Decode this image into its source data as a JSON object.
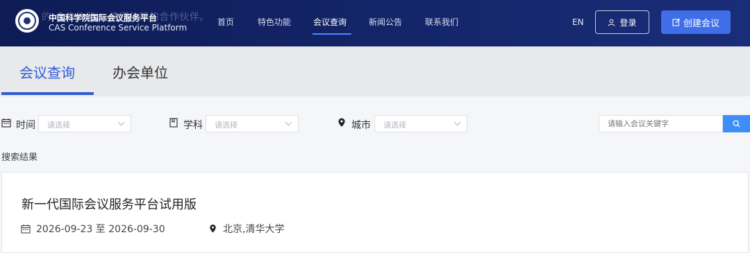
{
  "header": {
    "ghost_text": "的 合作伙伴。 值得信赖的合作伙伴。",
    "brand_cn": "中国科学院国际会议服务平台",
    "brand_en": "CAS Conference Service Platform",
    "nav": [
      {
        "label": "首页"
      },
      {
        "label": "特色功能"
      },
      {
        "label": "会议查询"
      },
      {
        "label": "新闻公告"
      },
      {
        "label": "联系我们"
      }
    ],
    "active_nav": "会议查询",
    "lang": "EN",
    "login_label": "登录",
    "create_label": "创建会议"
  },
  "tabs": [
    {
      "label": "会议查询",
      "active": true
    },
    {
      "label": "办会单位",
      "active": false
    }
  ],
  "filters": {
    "time": {
      "label": "时间",
      "placeholder": "请选择"
    },
    "subject": {
      "label": "学科",
      "placeholder": "请选择"
    },
    "city": {
      "label": "城市",
      "placeholder": "请选择"
    },
    "keyword_placeholder": "请输入会议关键字"
  },
  "results": {
    "label": "搜索结果",
    "items": [
      {
        "title": "新一代国际会议服务平台试用版",
        "date_range": "2026-09-23 至 2026-09-30",
        "location": "北京,清华大学"
      }
    ]
  },
  "colors": {
    "header_bg": "#14256a",
    "accent": "#2f5ad8",
    "create_button": "#3f6ee8",
    "search_button": "#3e8ef7"
  }
}
